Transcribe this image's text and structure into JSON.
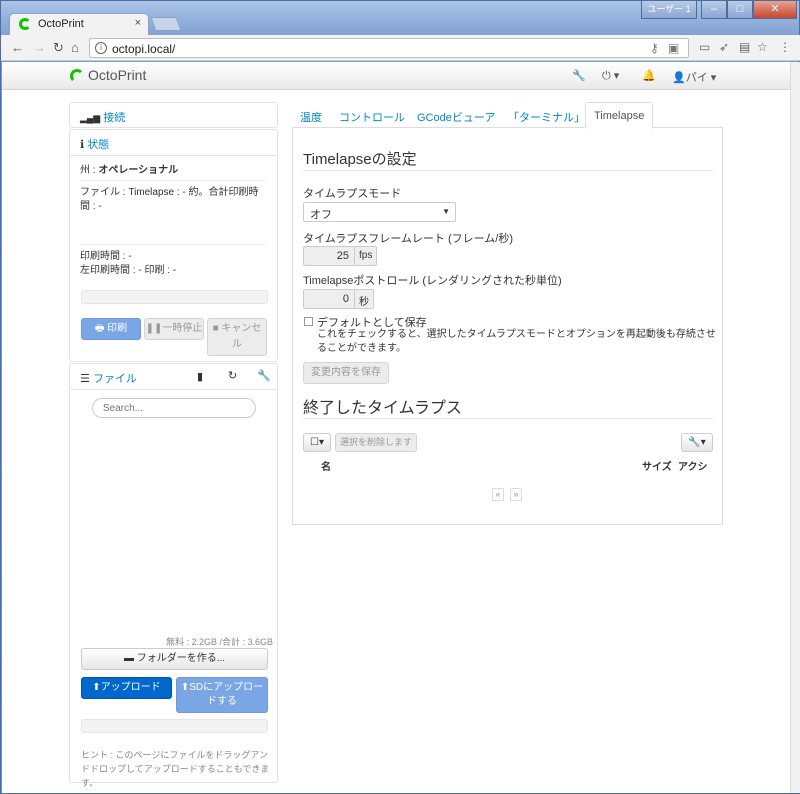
{
  "browser": {
    "tab_title": "OctoPrint",
    "tab_close": "×",
    "url": "octopi.local/",
    "win_user": "ユーザー 1"
  },
  "navbar": {
    "brand": "OctoPrint",
    "user": "パイ"
  },
  "sidebar": {
    "connection_title": "接続",
    "state_title": "状態",
    "state_label": "州 :",
    "state_value": "オペレーショナル",
    "file_line": "ファイル : Timelapse : - 約。合計印刷時間 : -",
    "print_time": "印刷時間 : -",
    "print_left": "左印刷時間 : - 印刷 : -",
    "btn_print": "印刷",
    "btn_pause": "一時停止",
    "btn_cancel": "キャンセル",
    "files_title": "ファイル",
    "search_placeholder": "Search...",
    "storage": "無料 : 2.2GB /合計 : 3.6GB",
    "btn_folder": "フォルダーを作る...",
    "btn_upload": "アップロード",
    "btn_upload_sd": "SDにアップロードする",
    "hint": "ヒント : このページにファイルをドラッグアンドドロップしてアップロードすることもできます。"
  },
  "tabs": [
    "温度",
    "コントロール",
    "GCodeビューア",
    "「ターミナル」",
    "Timelapse"
  ],
  "timelapse": {
    "settings_title": "Timelapseの設定",
    "mode_label": "タイムラプスモード",
    "mode_value": "オフ",
    "framerate_label": "タイムラプスフレームレート (フレーム/秒)",
    "framerate_value": "25",
    "framerate_unit": "fps",
    "postroll_label": "Timelapseポストロール (レンダリングされた秒単位)",
    "postroll_value": "0",
    "postroll_unit": "秒",
    "default_label": "デフォルトとして保存",
    "default_help": "これをチェックすると、選択したタイムラプスモードとオプションを再起動後も存続させることができます。",
    "btn_save": "変更内容を保存",
    "finished_title": "終了したタイムラプス",
    "btn_delete_selected": "選択を削除します",
    "col_name": "名",
    "col_size": "サイズ",
    "col_action": "アクシ",
    "pager_prev": "«",
    "pager_next": "»"
  }
}
